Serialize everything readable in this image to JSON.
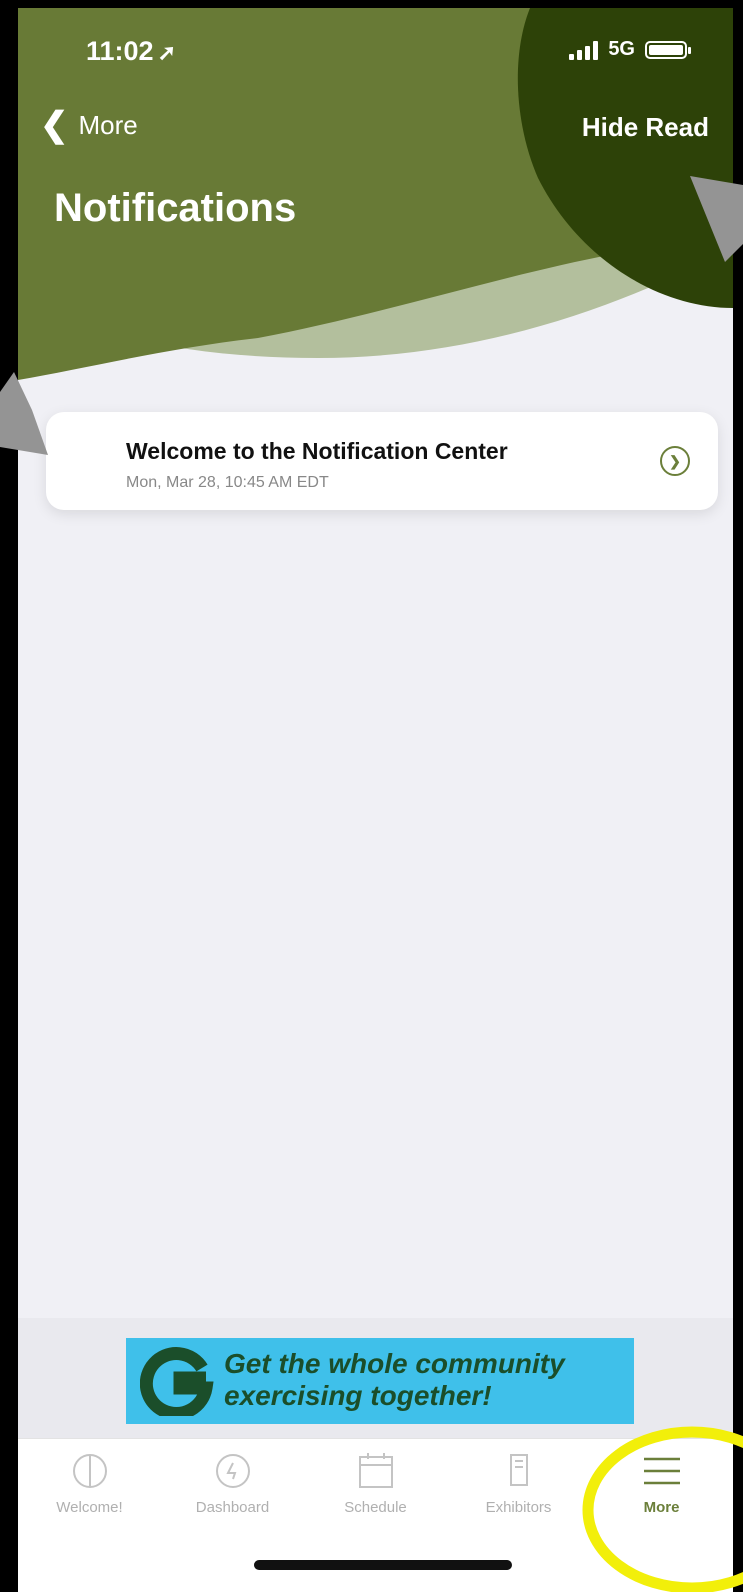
{
  "status_bar": {
    "time": "11:02",
    "network": "5G",
    "signal_bars": 4,
    "battery_level": 1.0
  },
  "nav": {
    "back_label": "More",
    "action_label": "Hide Read"
  },
  "page": {
    "title": "Notifications"
  },
  "notifications": [
    {
      "title": "Welcome to the Notification Center",
      "date": "Mon, Mar 28, 10:45 AM EDT"
    }
  ],
  "ad": {
    "line1": "Get the whole community",
    "line2": "exercising together!"
  },
  "tabs": [
    {
      "label": "Welcome!",
      "icon": "welcome-icon"
    },
    {
      "label": "Dashboard",
      "icon": "dashboard-icon"
    },
    {
      "label": "Schedule",
      "icon": "calendar-icon"
    },
    {
      "label": "Exhibitors",
      "icon": "exhibitors-icon"
    },
    {
      "label": "More",
      "icon": "menu-icon",
      "active": true
    }
  ],
  "colors": {
    "header_green": "#687a36",
    "header_dark": "#2d4208",
    "header_light": "#b3bf9d",
    "accent": "#6b7f3a",
    "ad_background": "#3fc0ea",
    "highlight_circle": "#f2ef0a"
  }
}
